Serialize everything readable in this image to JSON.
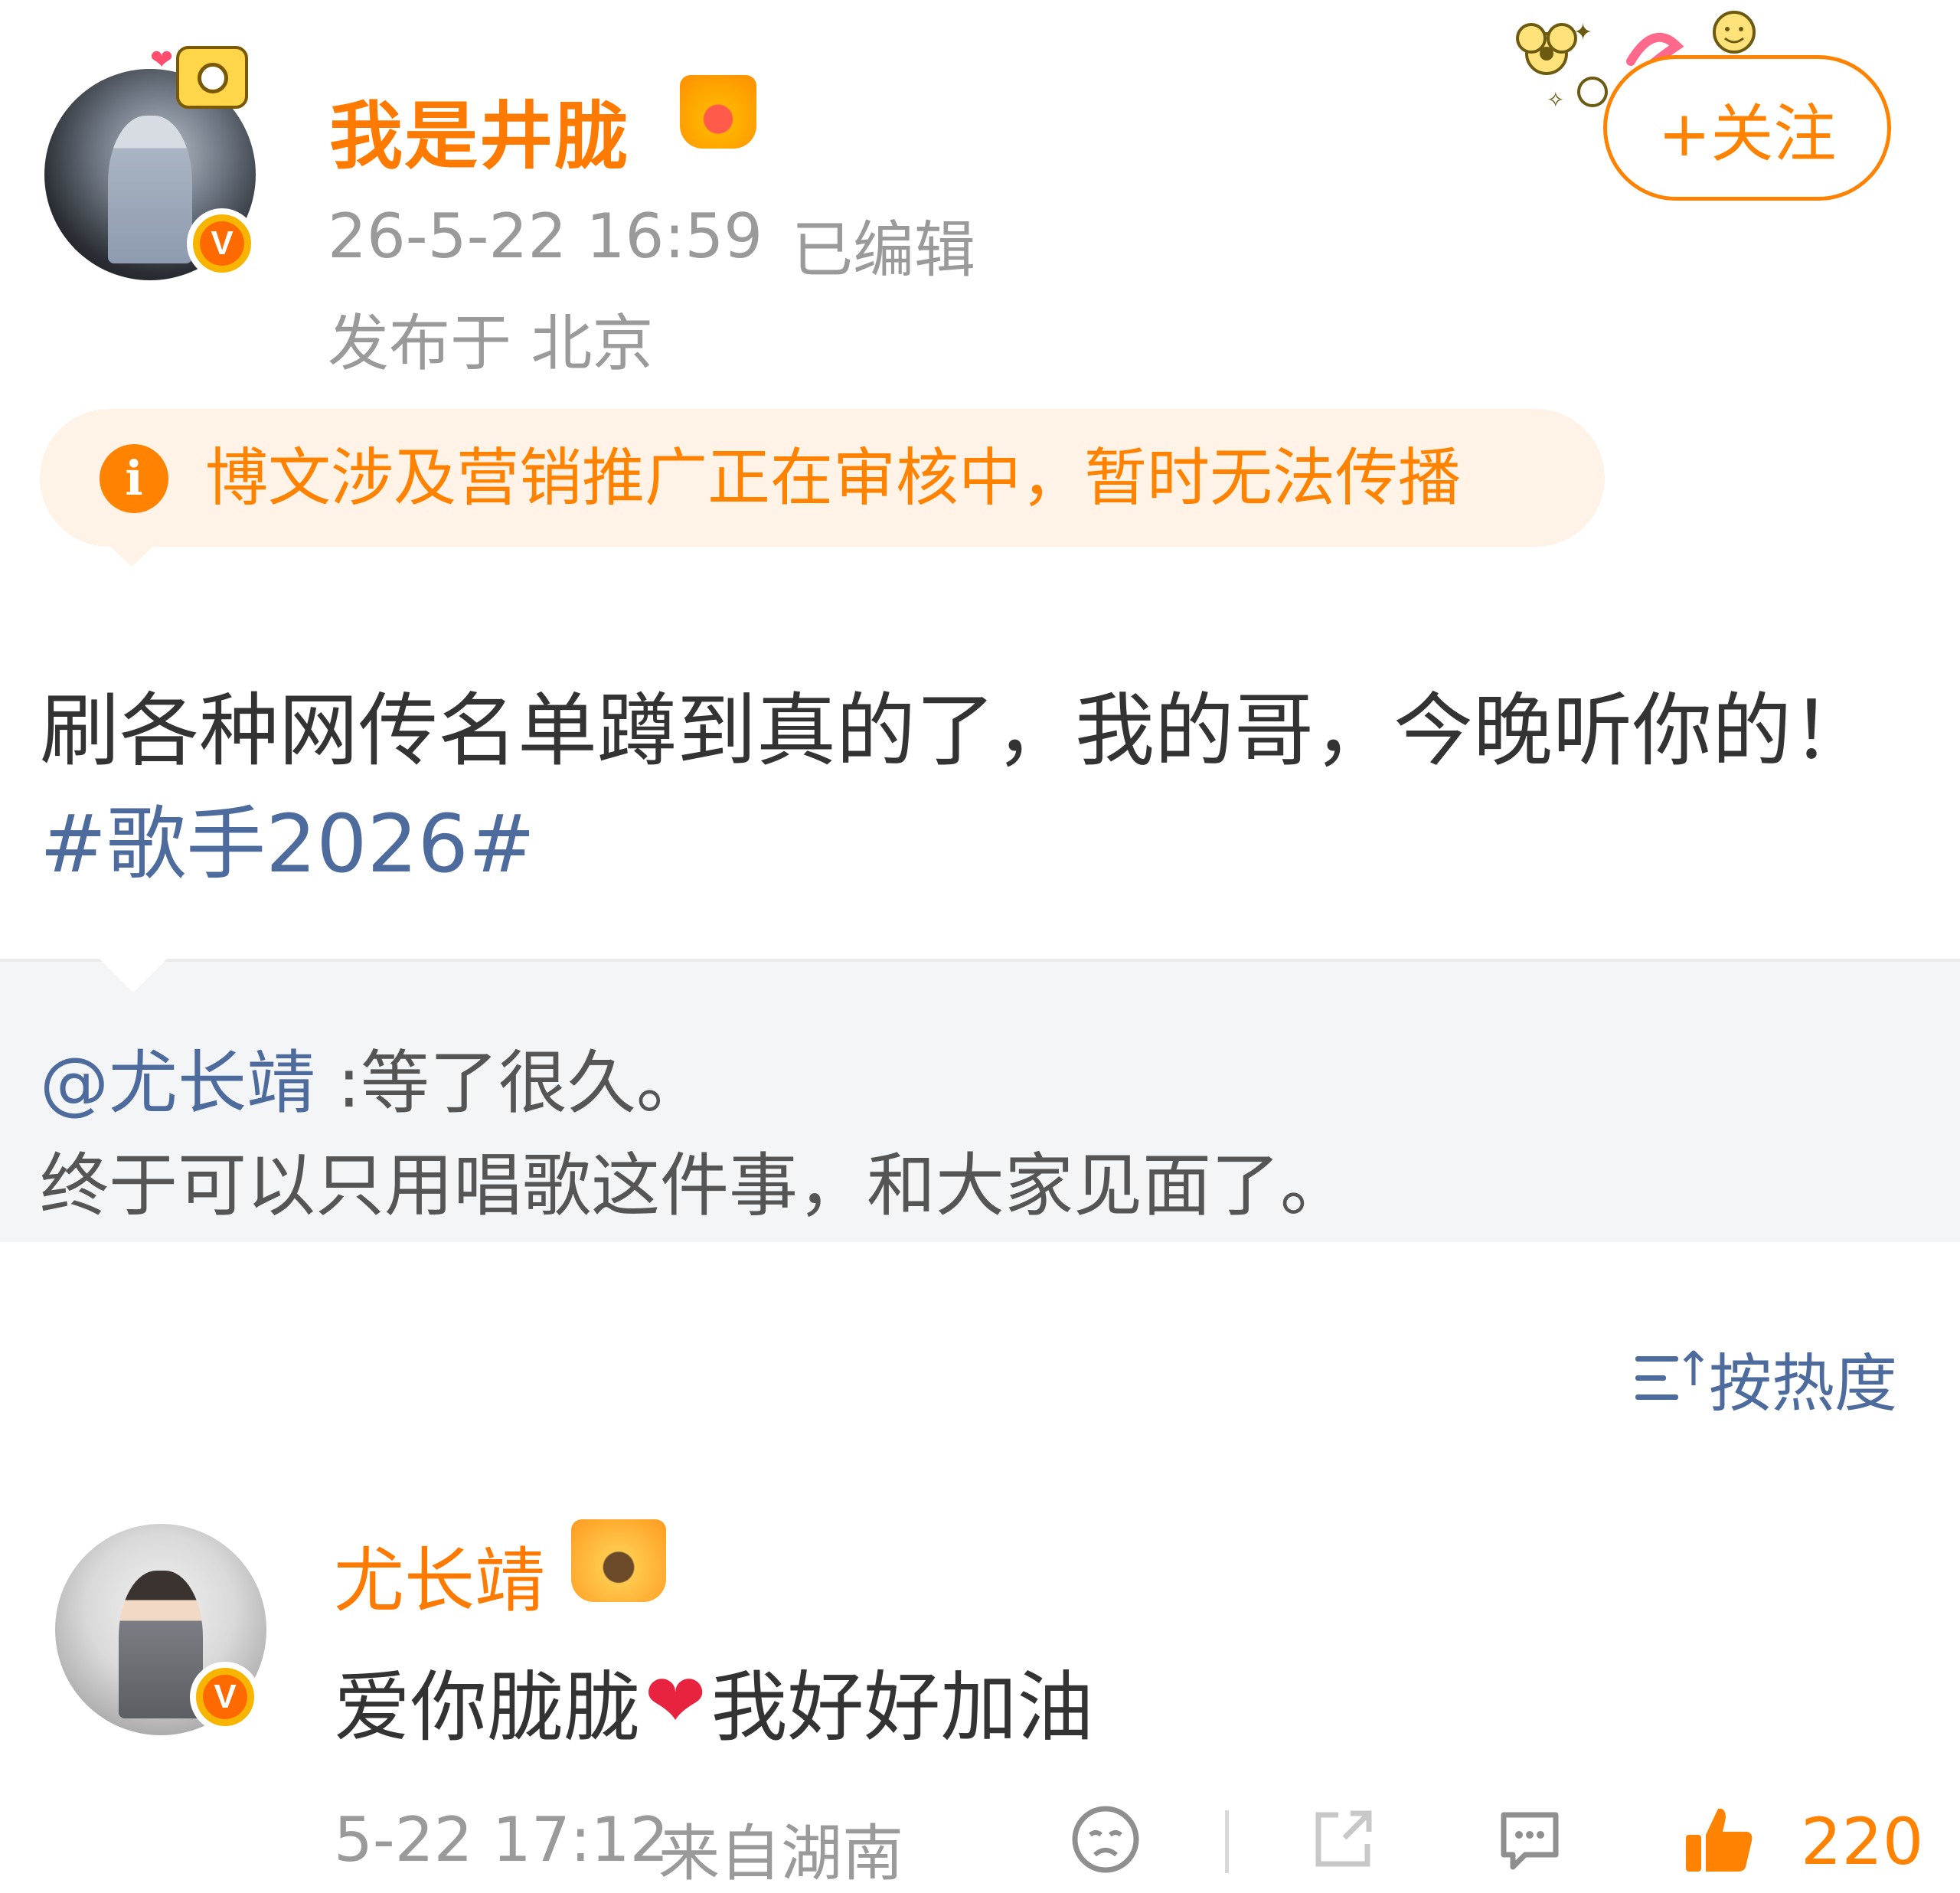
{
  "post": {
    "author": "我是井胧",
    "timestamp": "26-5-22 16:59",
    "edited": "已编辑",
    "location": "发布于 北京",
    "follow_label": "+关注",
    "notice": "博文涉及营销推广正在审核中，暂时无法传播",
    "body_text": "刷各种网传名单蹲到真的了，我的哥，今晚听你的！",
    "topic": "#歌手2026#"
  },
  "quote": {
    "mention": "@尤长靖",
    "line1": " :等了很久。",
    "line2": "终于可以只用唱歌这件事，和大家见面了。"
  },
  "sort": {
    "label": "按热度"
  },
  "comment": {
    "name": "尤长靖",
    "text_before": "爱你胧胧",
    "text_after": " 我好好加油",
    "timestamp": "5-22 17:12",
    "location": "来自湖南",
    "likes": "220"
  },
  "icons": {
    "verified_badge": "v-verified-icon",
    "info": "info-icon",
    "heart": "heart-emoji-icon",
    "sad_face": "sad-face-icon",
    "share": "share-icon",
    "comment": "comment-icon",
    "like": "thumbs-up-icon",
    "sort": "sort-icon"
  },
  "colors": {
    "accent_orange": "#ff8200",
    "link_blue": "#4e6b9e",
    "notice_bg": "#fff2e6",
    "quote_bg": "#f4f5f6"
  }
}
